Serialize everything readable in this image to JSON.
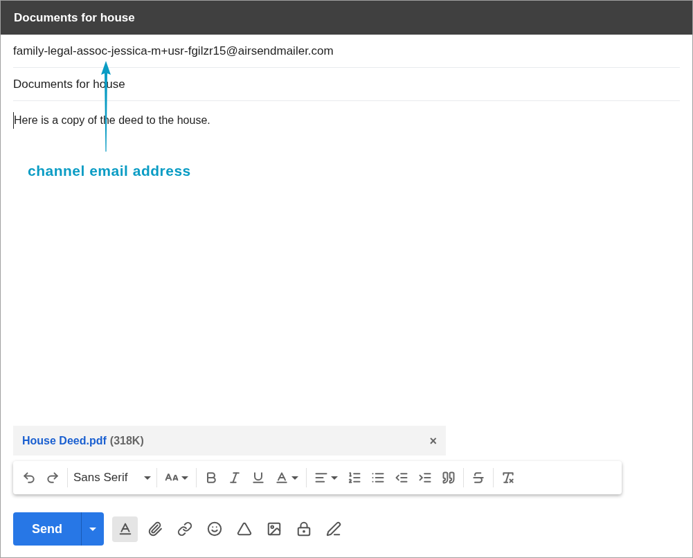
{
  "window": {
    "title": "Documents for house"
  },
  "to_field": {
    "value": "family-legal-assoc-jessica-m+usr-fgilzr15@airsendmailer.com"
  },
  "subject_field": {
    "value": "Documents for house"
  },
  "body": {
    "text": "Here is a copy of the deed to the house."
  },
  "annotation": {
    "label": "channel email address"
  },
  "attachment": {
    "name": "House Deed.pdf",
    "size": "(318K)",
    "remove": "×"
  },
  "formatting_toolbar": {
    "font": "Sans Serif"
  },
  "bottom_bar": {
    "send": "Send",
    "formatting_toggle": {
      "selected": true
    }
  }
}
